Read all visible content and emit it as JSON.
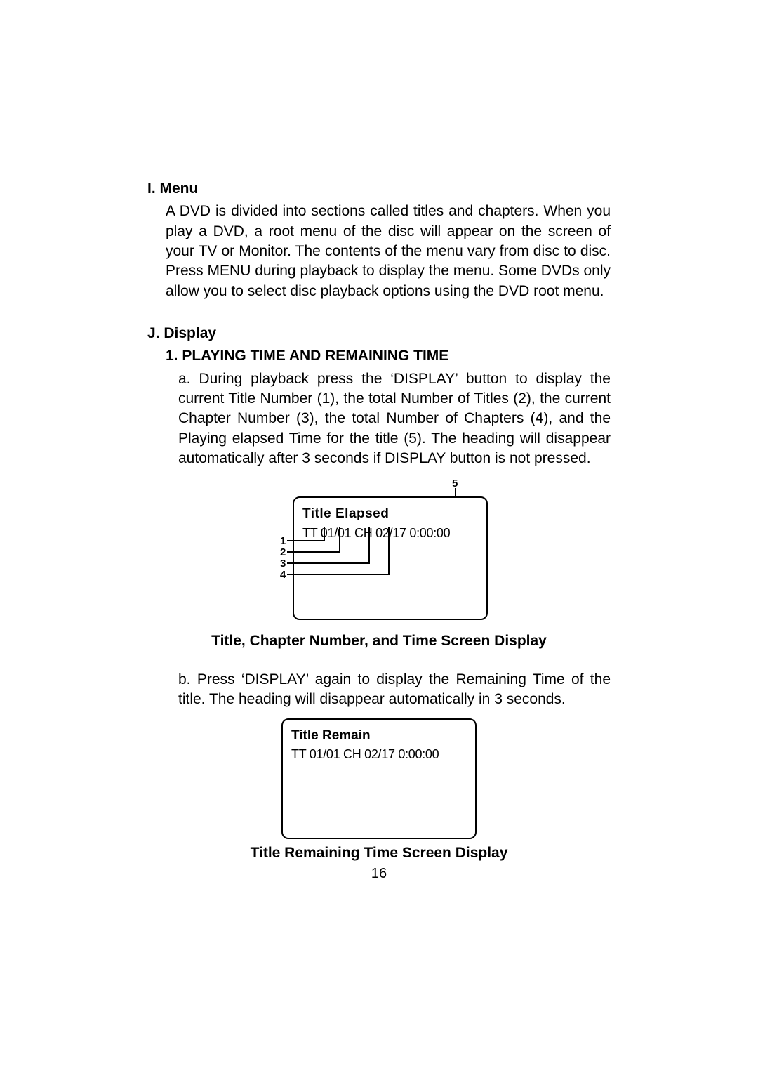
{
  "sectionI": {
    "heading": "I. Menu",
    "body": "A DVD is divided into sections called titles and chapters. When you play a DVD, a root menu of the disc will appear on the screen of your TV or Monitor. The contents of the menu vary from disc to disc. Press MENU during playback to display the menu. Some DVDs only allow you to select disc playback options using the DVD root menu."
  },
  "sectionJ": {
    "heading": "J. Display",
    "sub1": {
      "heading": "1. PLAYING TIME AND REMAINING TIME",
      "a": "a. During playback press the ‘DISPLAY’  button to display the current  Title Number (1), the total Number of Titles (2), the current Chapter Number (3), the total Number of Chapters (4), and the Playing  elapsed Time for the title (5). The heading will disappear automatically after 3 seconds if DISPLAY button is not pressed.",
      "b": "b. Press ‘DISPLAY’ again to display the Remaining Time of  the title. The heading will disappear automatically  in 3 seconds."
    }
  },
  "figure1": {
    "title": "Title Elapsed",
    "line2": "TT 01/01  CH 02/17  0:00:00",
    "callouts": {
      "n1": "1",
      "n2": "2",
      "n3": "3",
      "n4": "4",
      "n5": "5"
    },
    "caption": "Title, Chapter Number, and Time Screen Display"
  },
  "figure2": {
    "title": "Title Remain",
    "line2": "TT 01/01  CH 02/17  0:00:00",
    "caption": "Title Remaining Time Screen Display"
  },
  "pageNumber": "16"
}
